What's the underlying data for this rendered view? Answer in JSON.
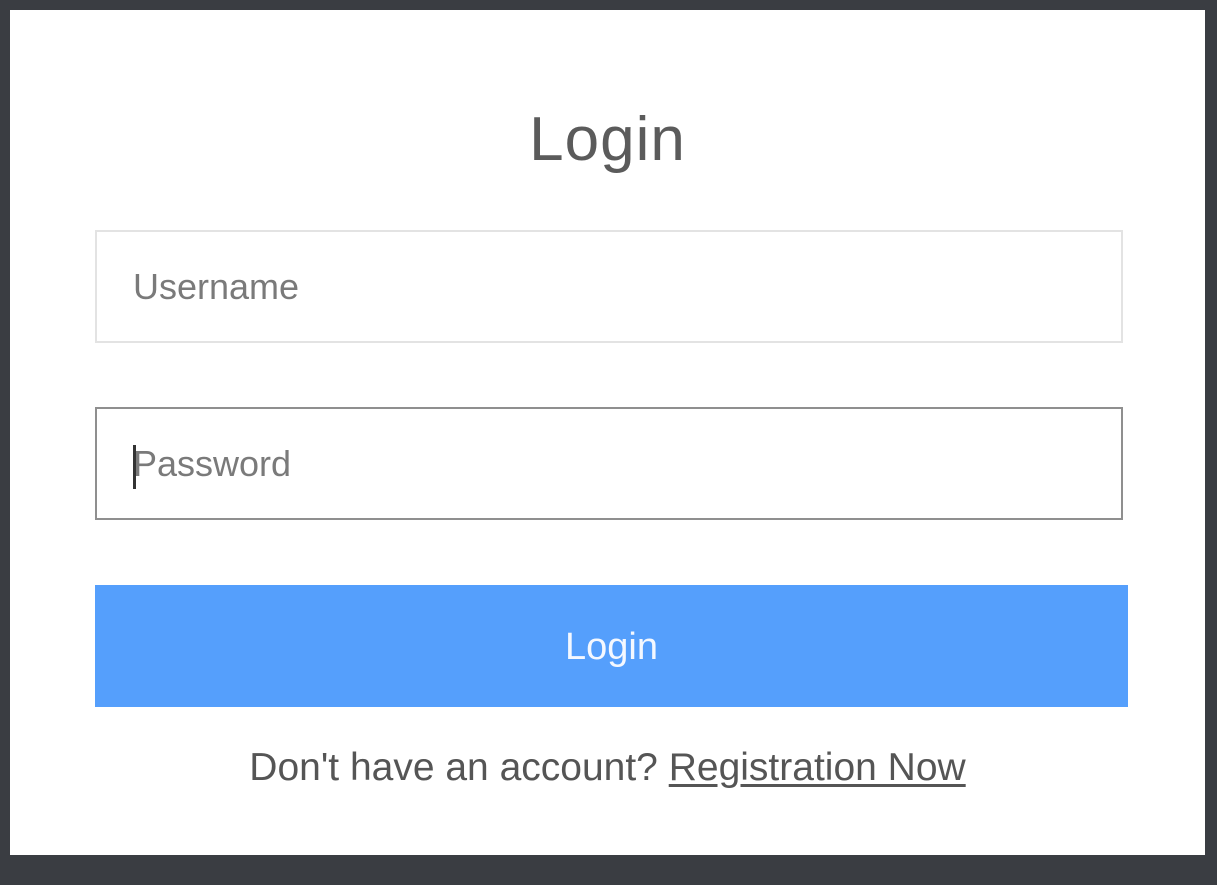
{
  "login": {
    "title": "Login",
    "username": {
      "placeholder": "Username",
      "value": ""
    },
    "password": {
      "placeholder": "Password",
      "value": ""
    },
    "submit_label": "Login",
    "register_prompt": "Don't have an account?",
    "register_link": "Registration Now"
  },
  "colors": {
    "accent": "#559ffc",
    "background": "#3a3d42",
    "panel": "#ffffff",
    "text": "#555555"
  }
}
